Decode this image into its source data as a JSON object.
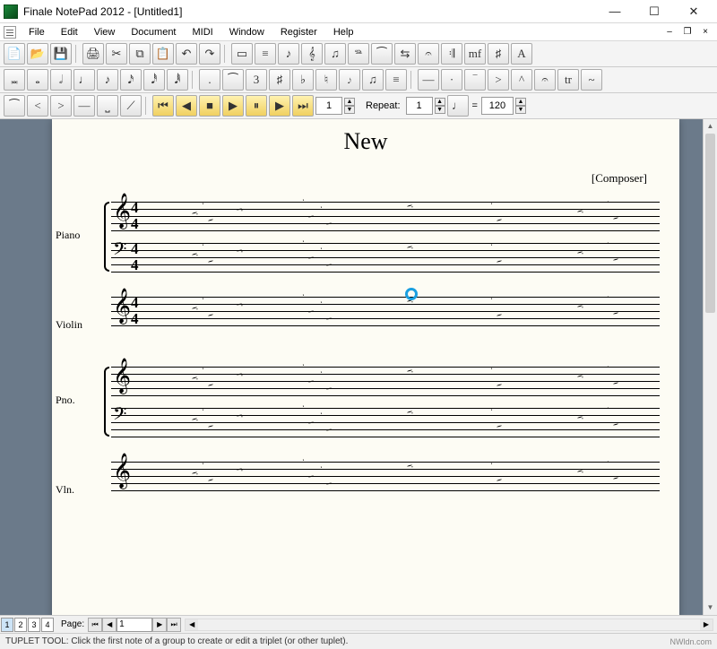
{
  "window": {
    "title": "Finale NotePad 2012 - [Untitled1]",
    "minimize": "—",
    "maximize": "☐",
    "close": "✕"
  },
  "menu": {
    "items": [
      "File",
      "Edit",
      "View",
      "Document",
      "MIDI",
      "Window",
      "Register",
      "Help"
    ],
    "mdi_min": "–",
    "mdi_restore": "❐",
    "mdi_close": "×"
  },
  "toolbar1": {
    "icons": [
      "new-doc-icon",
      "open-icon",
      "save-icon",
      "print-icon",
      "cut-icon",
      "copy-icon",
      "paste-icon",
      "undo-icon",
      "redo-icon",
      "tool-select-icon",
      "tool-staff-icon",
      "tool-entry-icon",
      "tool-smartshape-icon",
      "tool-lyric-icon",
      "tool-dynamic-icon",
      "tool-slur-icon",
      "tool-expression-icon",
      "tool-chord-icon",
      "tool-repeat-icon",
      "tool-text-icon",
      "tool-page-icon",
      "tool-transport-icon"
    ],
    "glyphs": [
      "📄",
      "📂",
      "💾",
      "🖨",
      "✂",
      "⧉",
      "📋",
      "↶",
      "↷",
      "▭",
      "≡",
      "♪",
      "𝄞",
      "♫",
      "𝆮",
      "⁀",
      "⇆",
      "𝄐",
      "𝄇",
      "mf",
      "♯",
      "A"
    ]
  },
  "toolbar2": {
    "icons": [
      "note-double-whole-icon",
      "note-whole-icon",
      "note-half-icon",
      "note-quarter-icon",
      "note-eighth-icon",
      "note-16th-icon",
      "note-32nd-icon",
      "note-64th-icon",
      "dot-icon",
      "tie-icon",
      "tuplet-icon",
      "sharp-icon",
      "flat-icon",
      "natural-icon",
      "grace-icon",
      "beam-icon",
      "tremolo-icon",
      "accent-icon",
      "staccato-icon",
      "tenuto-icon",
      "marcato-icon",
      "fermata-icon",
      "trill-icon",
      "mord-icon",
      "turn-icon"
    ],
    "glyphs": [
      "𝅜",
      "𝅝",
      "𝅗𝅥",
      "♩",
      "♪",
      "𝅘𝅥𝅯",
      "𝅘𝅥𝅰",
      "𝅘𝅥𝅱",
      ".",
      "⁀",
      "3",
      "♯",
      "♭",
      "♮",
      "𝆕",
      "♫",
      "≡",
      "—",
      "·",
      "‾",
      ">",
      "^",
      "𝄐",
      "tr",
      "~",
      "∿"
    ]
  },
  "toolbar3": {
    "icons": [
      "slur-icon",
      "cresc-icon",
      "decresc-icon",
      "line-icon",
      "bracket-icon",
      "gliss-icon"
    ],
    "glyphs": [
      "⁀",
      "<",
      ">",
      "—",
      "⎵",
      "⟋"
    ],
    "play_icons": [
      "rewind-icon",
      "back-icon",
      "stop-icon",
      "play-icon",
      "pause-icon",
      "forward-icon",
      "end-icon"
    ],
    "play_glyphs": [
      "⏮",
      "◀",
      "■",
      "▶",
      "⏸",
      "▶",
      "⏭"
    ],
    "measure_value": "1",
    "repeat_label": "Repeat:",
    "repeat_value": "1",
    "tempo_note": "♩",
    "tempo_eq": "=",
    "tempo_value": "120"
  },
  "score": {
    "title": "New",
    "composer": "[Composer]",
    "system1": {
      "inst1": "Piano",
      "inst2": "Violin"
    },
    "system2": {
      "inst1": "Pno.",
      "inst2": "Vln."
    },
    "timesig_top": "4",
    "timesig_bot": "4"
  },
  "pagebar": {
    "tabs": [
      "1",
      "2",
      "3",
      "4"
    ],
    "label": "Page:",
    "current": "1",
    "first": "⏮",
    "prev": "◀",
    "next": "▶",
    "last": "⏭"
  },
  "status": {
    "text": "TUPLET TOOL: Click the first note of a group to create or edit a triplet (or other tuplet).",
    "brand": "NWldn.com"
  }
}
